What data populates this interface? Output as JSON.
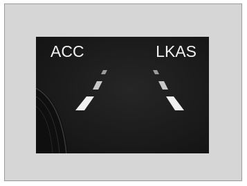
{
  "indicators": {
    "acc_label": "ACC",
    "lkas_label": "LKAS"
  },
  "icons": {
    "left_lane": "lane-marking-left-icon",
    "right_lane": "lane-marking-right-icon"
  },
  "colors": {
    "page_background": "#ffffff",
    "frame_background": "#d6d6d6",
    "frame_border": "#9a9a9a",
    "display_background": "#1b1b1b",
    "indicator_text": "#f2f2f2"
  }
}
